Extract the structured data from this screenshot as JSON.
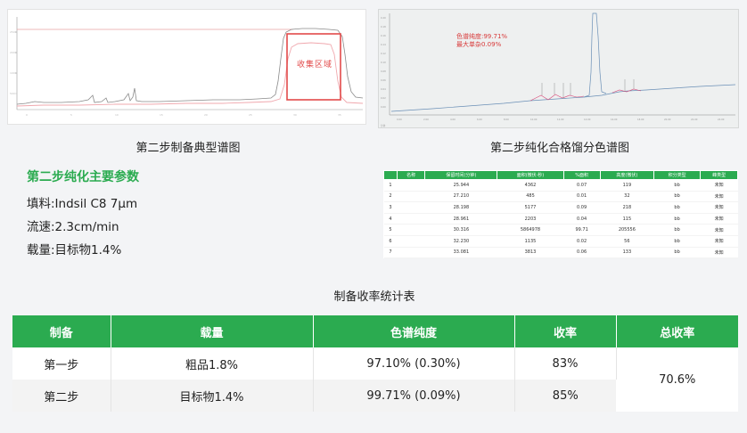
{
  "charts": {
    "left": {
      "caption": "第二步制备典型谱图",
      "collect_label": "收集区域"
    },
    "right": {
      "caption": "第二步纯化合格馏分色谱图",
      "purity": "色谱纯度:99.71%",
      "max_impurity": "最大单杂0.09%"
    }
  },
  "params": {
    "title": "第二步纯化主要参数",
    "filler": "填料:Indsil C8 7μm",
    "flow": "流速:2.3cm/min",
    "load": "载量:目标物1.4%"
  },
  "peak_table": {
    "headers": [
      "",
      "名称",
      "保留时间(分钟)",
      "面积(微伏·秒)",
      "%面积",
      "高度(微伏)",
      "积分类型",
      "峰类型"
    ],
    "rows": [
      [
        "1",
        "",
        "25.944",
        "4362",
        "0.07",
        "119",
        "bb",
        "未知"
      ],
      [
        "2",
        "",
        "27.210",
        "485",
        "0.01",
        "32",
        "bb",
        "未知"
      ],
      [
        "3",
        "",
        "28.198",
        "5177",
        "0.09",
        "218",
        "bb",
        "未知"
      ],
      [
        "4",
        "",
        "28.961",
        "2203",
        "0.04",
        "115",
        "bb",
        "未知"
      ],
      [
        "5",
        "",
        "30.316",
        "5864978",
        "99.71",
        "205556",
        "bb",
        "未知"
      ],
      [
        "6",
        "",
        "32.230",
        "1135",
        "0.02",
        "56",
        "bb",
        "未知"
      ],
      [
        "7",
        "",
        "33.081",
        "3813",
        "0.06",
        "133",
        "bb",
        "未知"
      ]
    ]
  },
  "yield_table": {
    "title": "制备收率统计表",
    "headers": [
      "制备",
      "载量",
      "色谱纯度",
      "收率",
      "总收率"
    ],
    "rows": [
      {
        "step": "第一步",
        "load": "粗品1.8%",
        "purity": "97.10% (0.30%)",
        "yield": "83%"
      },
      {
        "step": "第二步",
        "load": "目标物1.4%",
        "purity": "99.71% (0.09%)",
        "yield": "85%"
      }
    ],
    "total_yield": "70.6%"
  },
  "colors": {
    "accent_green": "#2bab50",
    "chart_red": "#e24a4a"
  }
}
